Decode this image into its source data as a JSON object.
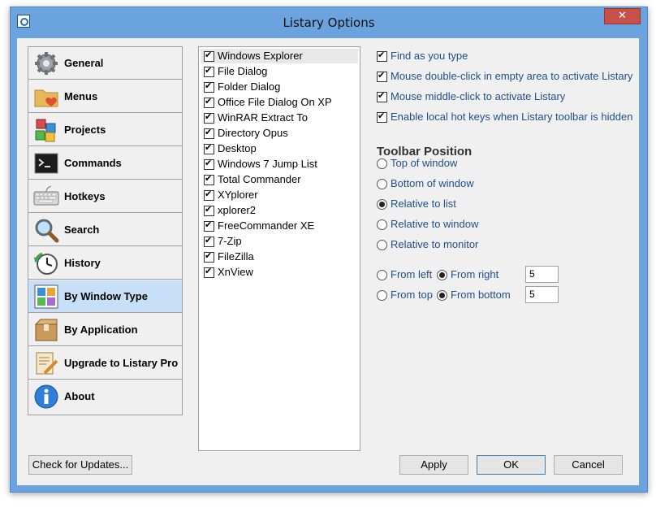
{
  "window": {
    "title": "Listary Options",
    "close_symbol": "✕"
  },
  "sidebar": {
    "items": [
      {
        "label": "General",
        "icon": "gear-icon",
        "active": false
      },
      {
        "label": "Menus",
        "icon": "folder-heart-icon",
        "active": false
      },
      {
        "label": "Projects",
        "icon": "cubes-icon",
        "active": false
      },
      {
        "label": "Commands",
        "icon": "terminal-icon",
        "active": false
      },
      {
        "label": "Hotkeys",
        "icon": "keyboard-icon",
        "active": false
      },
      {
        "label": "Search",
        "icon": "magnifier-icon",
        "active": false
      },
      {
        "label": "History",
        "icon": "clock-icon",
        "active": false
      },
      {
        "label": "By Window Type",
        "icon": "window-grid-icon",
        "active": true
      },
      {
        "label": "By Application",
        "icon": "package-icon",
        "active": false
      },
      {
        "label": "Upgrade to Listary Pro",
        "icon": "certificate-icon",
        "active": false
      },
      {
        "label": "About",
        "icon": "info-icon",
        "active": false
      }
    ]
  },
  "window_types": [
    {
      "label": "Windows Explorer",
      "checked": true
    },
    {
      "label": "File Dialog",
      "checked": true
    },
    {
      "label": "Folder Dialog",
      "checked": true
    },
    {
      "label": "Office File Dialog On XP",
      "checked": true
    },
    {
      "label": "WinRAR Extract To",
      "checked": true
    },
    {
      "label": "Directory Opus",
      "checked": true
    },
    {
      "label": "Desktop",
      "checked": true
    },
    {
      "label": "Windows 7 Jump List",
      "checked": true
    },
    {
      "label": "Total Commander",
      "checked": true
    },
    {
      "label": "XYplorer",
      "checked": true
    },
    {
      "label": "xplorer2",
      "checked": true
    },
    {
      "label": "FreeCommander XE",
      "checked": true
    },
    {
      "label": "7-Zip",
      "checked": true
    },
    {
      "label": "FileZilla",
      "checked": true
    },
    {
      "label": "XnView",
      "checked": true
    }
  ],
  "options": [
    {
      "label": "Find as you type",
      "checked": true
    },
    {
      "label": "Mouse double-click in empty area to activate Listary",
      "checked": true
    },
    {
      "label": "Mouse middle-click to activate Listary",
      "checked": true
    },
    {
      "label": "Enable local hot keys when Listary toolbar is hidden",
      "checked": true
    }
  ],
  "toolbar_position": {
    "title": "Toolbar Position",
    "choices": [
      {
        "label": "Top of window",
        "selected": false
      },
      {
        "label": "Bottom of window",
        "selected": false
      },
      {
        "label": "Relative to list",
        "selected": true
      },
      {
        "label": "Relative to window",
        "selected": false
      },
      {
        "label": "Relative to monitor",
        "selected": false
      }
    ],
    "from_left": {
      "label": "From left",
      "selected": false
    },
    "from_right": {
      "label": "From right",
      "selected": true
    },
    "horizontal_value": "5",
    "from_top": {
      "label": "From top",
      "selected": false
    },
    "from_bottom": {
      "label": "From bottom",
      "selected": true
    },
    "vertical_value": "5"
  },
  "buttons": {
    "check_updates": "Check for Updates...",
    "apply": "Apply",
    "ok": "OK",
    "cancel": "Cancel"
  }
}
